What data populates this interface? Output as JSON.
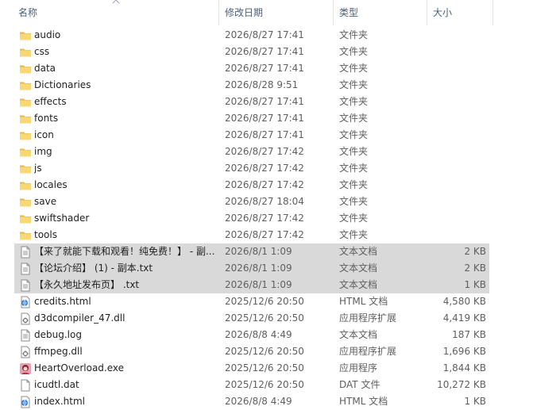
{
  "columns": {
    "name": "名称",
    "date": "修改日期",
    "type": "类型",
    "size": "大小"
  },
  "rows": [
    {
      "name": "audio",
      "date": "2026/8/27 17:41",
      "type": "文件夹",
      "size": "",
      "icon": "folder-icon"
    },
    {
      "name": "css",
      "date": "2026/8/27 17:41",
      "type": "文件夹",
      "size": "",
      "icon": "folder-icon"
    },
    {
      "name": "data",
      "date": "2026/8/27 17:41",
      "type": "文件夹",
      "size": "",
      "icon": "folder-icon"
    },
    {
      "name": "Dictionaries",
      "date": "2026/8/28 9:51",
      "type": "文件夹",
      "size": "",
      "icon": "folder-icon"
    },
    {
      "name": "effects",
      "date": "2026/8/27 17:41",
      "type": "文件夹",
      "size": "",
      "icon": "folder-icon"
    },
    {
      "name": "fonts",
      "date": "2026/8/27 17:41",
      "type": "文件夹",
      "size": "",
      "icon": "folder-icon"
    },
    {
      "name": "icon",
      "date": "2026/8/27 17:41",
      "type": "文件夹",
      "size": "",
      "icon": "folder-icon"
    },
    {
      "name": "img",
      "date": "2026/8/27 17:42",
      "type": "文件夹",
      "size": "",
      "icon": "folder-icon"
    },
    {
      "name": "js",
      "date": "2026/8/27 17:42",
      "type": "文件夹",
      "size": "",
      "icon": "folder-icon"
    },
    {
      "name": "locales",
      "date": "2026/8/27 17:42",
      "type": "文件夹",
      "size": "",
      "icon": "folder-icon"
    },
    {
      "name": "save",
      "date": "2026/8/27 18:04",
      "type": "文件夹",
      "size": "",
      "icon": "folder-icon"
    },
    {
      "name": "swiftshader",
      "date": "2026/8/27 17:42",
      "type": "文件夹",
      "size": "",
      "icon": "folder-icon"
    },
    {
      "name": "tools",
      "date": "2026/8/27 17:42",
      "type": "文件夹",
      "size": "",
      "icon": "folder-icon"
    },
    {
      "name": "【来了就能下载和观看！纯免费！】 - 副...",
      "date": "2026/8/1 1:09",
      "type": "文本文档",
      "size": "2 KB",
      "icon": "text-file-icon",
      "selected": true
    },
    {
      "name": "【论坛介绍】 (1) - 副本.txt",
      "date": "2026/8/1 1:09",
      "type": "文本文档",
      "size": "2 KB",
      "icon": "text-file-icon",
      "selected": true
    },
    {
      "name": "【永久地址发布页】 .txt",
      "date": "2026/8/1 1:09",
      "type": "文本文档",
      "size": "1 KB",
      "icon": "text-file-icon",
      "selected": true
    },
    {
      "name": "credits.html",
      "date": "2025/12/6 20:50",
      "type": "HTML 文档",
      "size": "4,580 KB",
      "icon": "html-file-icon"
    },
    {
      "name": "d3dcompiler_47.dll",
      "date": "2025/12/6 20:50",
      "type": "应用程序扩展",
      "size": "4,419 KB",
      "icon": "dll-file-icon"
    },
    {
      "name": "debug.log",
      "date": "2026/8/8 4:49",
      "type": "文本文档",
      "size": "187 KB",
      "icon": "text-file-icon"
    },
    {
      "name": "ffmpeg.dll",
      "date": "2025/12/6 20:50",
      "type": "应用程序扩展",
      "size": "1,696 KB",
      "icon": "dll-file-icon"
    },
    {
      "name": "HeartOverload.exe",
      "date": "2025/12/6 20:50",
      "type": "应用程序",
      "size": "1,844 KB",
      "icon": "app-exe-icon"
    },
    {
      "name": "icudtl.dat",
      "date": "2025/12/6 20:50",
      "type": "DAT 文件",
      "size": "10,272 KB",
      "icon": "blank-file-icon"
    },
    {
      "name": "index.html",
      "date": "2026/8/8 4:49",
      "type": "HTML 文档",
      "size": "1 KB",
      "icon": "html-file-icon"
    }
  ],
  "colors": {
    "selected_bg": "#d9d9d9",
    "folder": "#f8d775",
    "header_text": "#4c607a"
  }
}
